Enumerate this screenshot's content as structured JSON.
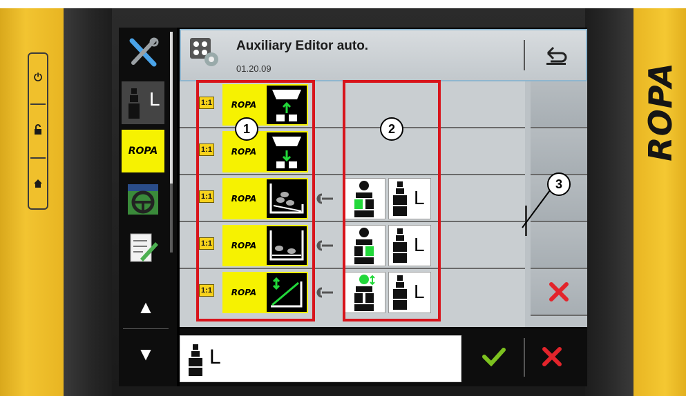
{
  "device": {
    "brand_text": "ROPA",
    "hardware_buttons": [
      {
        "icon": "power-icon",
        "glyph": "⏻"
      },
      {
        "icon": "unlock-icon",
        "glyph": "🔓"
      },
      {
        "icon": "home-icon",
        "glyph": "⌂"
      }
    ]
  },
  "nav": {
    "items": [
      {
        "name": "tools-icon"
      },
      {
        "name": "joystick-L-icon",
        "label": "L"
      },
      {
        "name": "ropa-logo-icon",
        "label": "ROPA"
      },
      {
        "name": "steering-wheel-icon"
      },
      {
        "name": "notepad-icon"
      }
    ],
    "up_icon": "▲",
    "down_icon": "▼"
  },
  "header": {
    "title": "Auxiliary Editor auto.",
    "version": "01.20.09"
  },
  "rows": [
    {
      "badge": "1:1",
      "brand": "ROPA",
      "function_icon": "hopper-raise-icon",
      "assigned": false
    },
    {
      "badge": "1:1",
      "brand": "ROPA",
      "function_icon": "hopper-lower-icon",
      "assigned": false
    },
    {
      "badge": "1:1",
      "brand": "ROPA",
      "function_icon": "bunker-tilt-left-icon",
      "assigned": true,
      "joystick_label": "L"
    },
    {
      "badge": "1:1",
      "brand": "ROPA",
      "function_icon": "bunker-flat-icon",
      "assigned": true,
      "joystick_label": "L"
    },
    {
      "badge": "1:1",
      "brand": "ROPA",
      "function_icon": "boom-angle-icon",
      "assigned": true,
      "joystick_label": "L"
    }
  ],
  "callouts": [
    {
      "label": "1"
    },
    {
      "label": "2"
    },
    {
      "label": "3"
    }
  ],
  "bottom": {
    "input_value": "L",
    "ok_icon": "✓",
    "cancel_icon": "✕"
  },
  "colors": {
    "accent_yellow": "#f6f201",
    "callout_red": "#d8141b",
    "ok_green": "#7cc11f",
    "cancel_red": "#e3242b",
    "active_green": "#22d83a"
  }
}
